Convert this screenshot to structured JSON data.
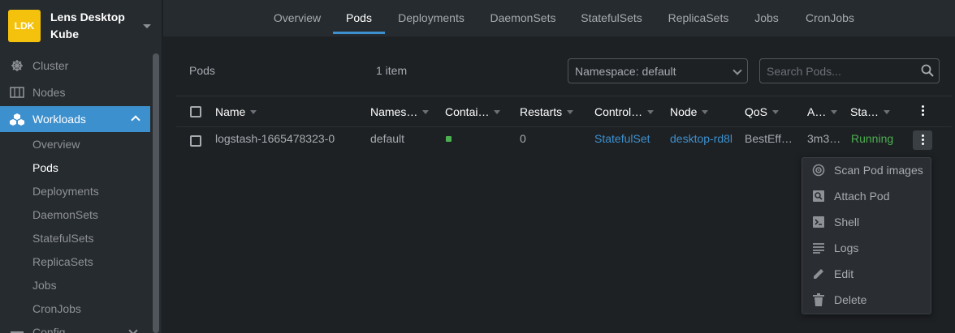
{
  "cluster": {
    "badge": "LDK",
    "name": "Lens Desktop Kube"
  },
  "sidebar": {
    "items": [
      {
        "label": "Cluster",
        "icon": "helm-wheel-icon"
      },
      {
        "label": "Nodes",
        "icon": "server-icon"
      },
      {
        "label": "Workloads",
        "icon": "cubes-icon"
      },
      {
        "label": "Config",
        "icon": "list-icon"
      }
    ],
    "workloads_sub": [
      "Overview",
      "Pods",
      "Deployments",
      "DaemonSets",
      "StatefulSets",
      "ReplicaSets",
      "Jobs",
      "CronJobs"
    ],
    "active_sub": "Pods"
  },
  "tabs": [
    "Overview",
    "Pods",
    "Deployments",
    "DaemonSets",
    "StatefulSets",
    "ReplicaSets",
    "Jobs",
    "CronJobs"
  ],
  "active_tab": "Pods",
  "panel": {
    "title": "Pods",
    "count": "1 item",
    "namespace_select": "Namespace: default",
    "search_placeholder": "Search Pods..."
  },
  "table": {
    "headers": [
      "Name",
      "Names…",
      "Contai…",
      "Restarts",
      "Control…",
      "Node",
      "QoS",
      "A…",
      "Sta…"
    ],
    "row": {
      "name": "logstash-1665478323-0",
      "namespace": "default",
      "restarts": "0",
      "controller": "StatefulSet",
      "node": "desktop-rd8l",
      "qos": "BestEff…",
      "age": "3m3…",
      "status": "Running"
    }
  },
  "context_menu": [
    {
      "label": "Scan Pod images",
      "icon": "scan-icon"
    },
    {
      "label": "Attach Pod",
      "icon": "attach-icon"
    },
    {
      "label": "Shell",
      "icon": "terminal-icon"
    },
    {
      "label": "Logs",
      "icon": "logs-icon"
    },
    {
      "label": "Edit",
      "icon": "pencil-icon"
    },
    {
      "label": "Delete",
      "icon": "trash-icon"
    }
  ],
  "colors": {
    "accent": "#3d90ce",
    "badge": "#f4c20d",
    "running": "#4caf50"
  }
}
